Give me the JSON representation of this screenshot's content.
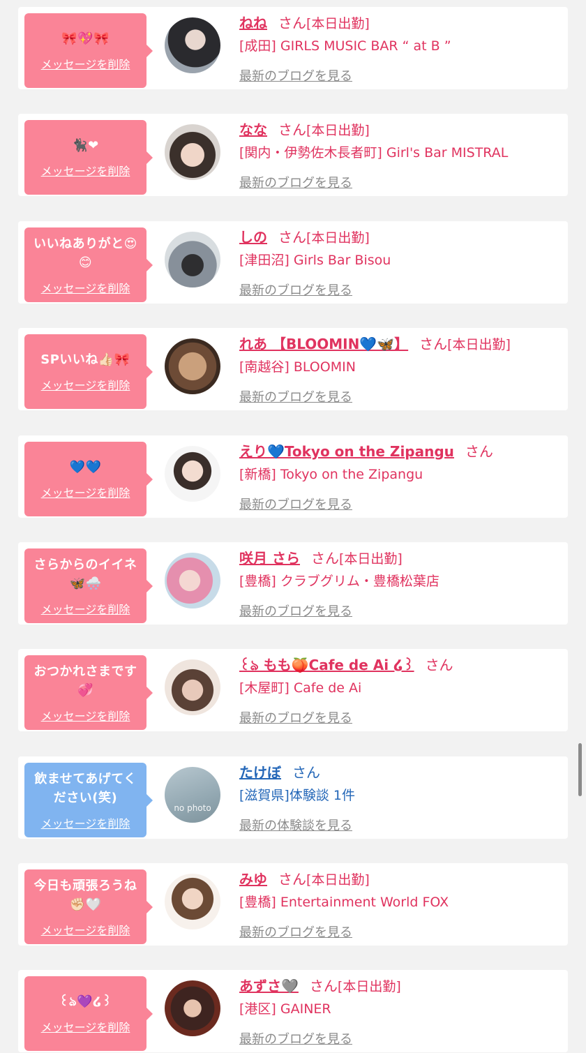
{
  "labels": {
    "delete": "メッセージを削除",
    "san": "さん"
  },
  "colors": {
    "pink_bubble": "#fa8497",
    "blue_bubble": "#80b4f0",
    "pink_text": "#e0335f",
    "blue_text": "#2467b8"
  },
  "items": [
    {
      "message": "🎀💖🎀",
      "name": "ねね",
      "status": "[本日出勤]",
      "shop": "[成田] GIRLS MUSIC BAR “ at B ”",
      "blog": "最新のブログを見る",
      "theme": "pink",
      "avatar": "avatar-1"
    },
    {
      "message": "🐈‍⬛❤︎",
      "name": "なな",
      "status": "[本日出勤]",
      "shop": "[関内・伊勢佐木長者町] Girl's Bar MISTRAL",
      "blog": "最新のブログを見る",
      "theme": "pink",
      "avatar": "avatar-2"
    },
    {
      "message": "いいねありがと😍😊",
      "name": "しの",
      "status": "[本日出勤]",
      "shop": "[津田沼] Girls Bar Bisou",
      "blog": "最新のブログを見る",
      "theme": "pink",
      "avatar": "avatar-3"
    },
    {
      "message": "SPいいね👍🏻🎀",
      "name": "れあ 【BLOOMIN💙🦋】",
      "status": "[本日出勤]",
      "shop": "[南越谷] BLOOMIN",
      "blog": "最新のブログを見る",
      "theme": "pink",
      "avatar": "avatar-4"
    },
    {
      "message": "💙💙",
      "name": "えり💙Tokyo on the Zipangu",
      "status": "",
      "shop": "[新橋] Tokyo on the Zipangu",
      "blog": "最新のブログを見る",
      "theme": "pink",
      "avatar": "avatar-5"
    },
    {
      "message": "さらからのイイネ🦋🌨️",
      "name": "咲月 さら",
      "status": "[本日出勤]",
      "shop": "[豊橋] クラブグリム・豊橋松葉店",
      "blog": "最新のブログを見る",
      "theme": "pink",
      "avatar": "avatar-6"
    },
    {
      "message": "おつかれさまです💞",
      "name": "꒰ঌ もも🍑Cafe de Ai ໒꒱",
      "status": "",
      "shop": "[木屋町] Cafe de Ai",
      "blog": "最新のブログを見る",
      "theme": "pink",
      "avatar": "avatar-7"
    },
    {
      "message": "飲ませてあげてください(笑)",
      "name": "たけぼ",
      "status": "",
      "shop": "[滋賀県]体験談 1件",
      "blog": "最新の体験談を見る",
      "theme": "blue",
      "avatar": "no photo"
    },
    {
      "message": "今日も頑張ろうね✊🏻🤍",
      "name": "みゆ",
      "status": "[本日出勤]",
      "shop": "[豊橋] Entertainment World FOX",
      "blog": "最新のブログを見る",
      "theme": "pink",
      "avatar": "avatar-9"
    },
    {
      "message": "꒰ঌ💜໒꒱",
      "name": "あずさ🩶",
      "status": "[本日出勤]",
      "shop": "[港区] GAINER",
      "blog": "最新のブログを見る",
      "theme": "pink",
      "avatar": "avatar-10"
    }
  ]
}
